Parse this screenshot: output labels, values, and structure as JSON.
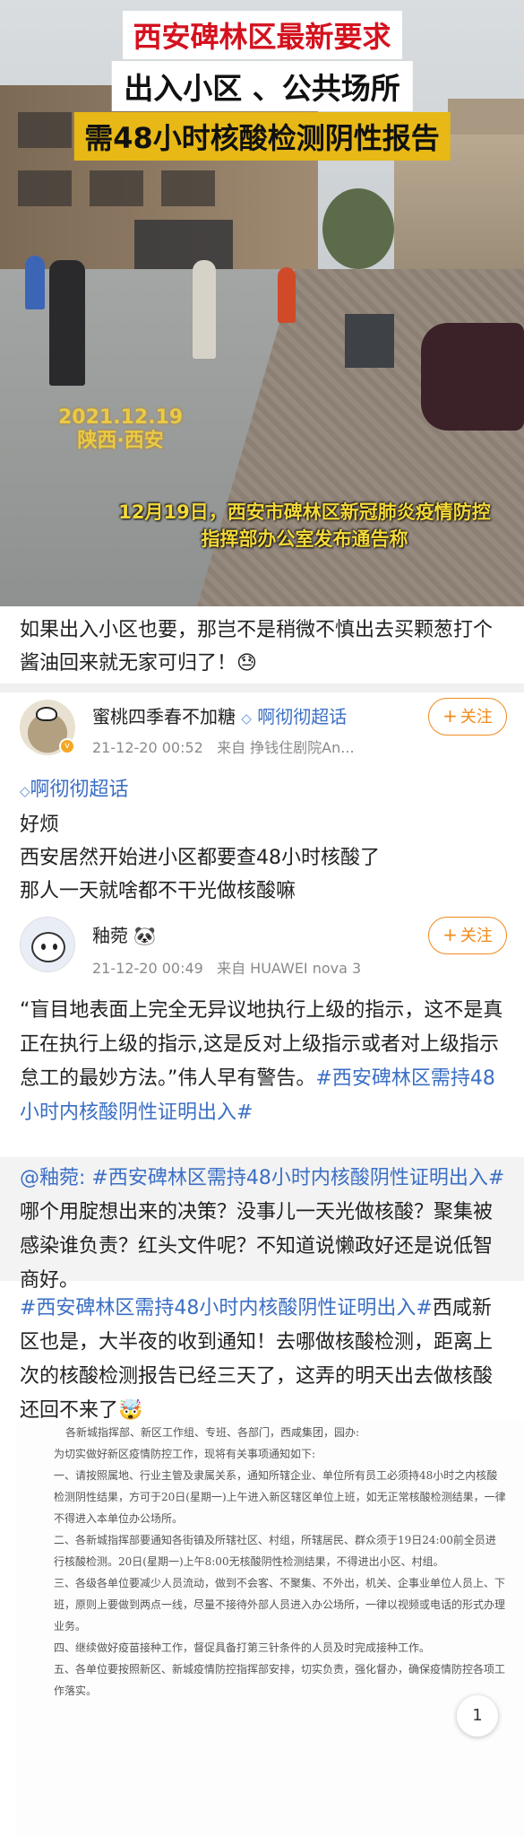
{
  "news_image": {
    "headline_1": "西安碑林区最新要求",
    "headline_2": "出入小区 、公共场所",
    "headline_3": "需48小时核酸检测阴性报告",
    "date_overlay": "2021.12.19",
    "location_overlay": "陕西·西安",
    "caption": "12月19日，西安市碑林区新冠肺炎疫情防控指挥部办公室发布通告称"
  },
  "intro_comment": "如果出入小区也要，那岂不是稍微不慎出去买颗葱打个酱油回来就无家可归了！😓",
  "posts": [
    {
      "username": "蜜桃四季春不加糖",
      "chaohua": "啊彻彻超话",
      "time": "21-12-20 00:52",
      "source": "来自 挣钱住剧院An...",
      "follow_label": "关注",
      "topic_tag": "啊彻彻超话",
      "body": [
        "好烦",
        "西安居然开始进小区都要查48小时核酸了",
        "那人一天就啥都不干光做核酸嘛"
      ]
    },
    {
      "username": "釉菀",
      "time": "21-12-20 00:49",
      "source": "来自 HUAWEI nova 3",
      "follow_label": "关注",
      "body_text": "“盲目地表面上完全无异议地执行上级的指示，这不是真正在执行上级的指示,这是反对上级指示或者对上级指示怠工的最妙方法。”伟人早有警告。",
      "body_tag": "#西安碑林区需持48小时内核酸阴性证明出入#"
    }
  ],
  "repost": {
    "mention": "@釉菀:",
    "tag": "#西安碑林区需持48小时内核酸阴性证明出入#",
    "text": "哪个用腚想出来的决策？没事儿一天光做核酸？聚集被感染谁负责？红头文件呢？不知道说懒政好还是说低智商好。"
  },
  "final_post": {
    "tag": "#西安碑林区需持48小时内核酸阴性证明出入#",
    "text": "西咸新区也是，大半夜的收到通知！去哪做核酸检测，距离上次的核酸检测报告已经三天了，这弄的明天出去做核酸还回不来了🤯"
  },
  "document": {
    "paragraphs": [
      "各新城指挥部、新区工作组、专班、各部门，西咸集团，园办:",
      "为切实做好新区疫情防控工作，现将有关事项通知如下:",
      "一、请按照属地、行业主管及隶属关系，通知所辖企业、单位所有员工必须持48小时之内核酸检测阴性结果，方可于20日(星期一)上午进入新区辖区单位上班，如无正常核酸检测结果，一律不得进入本单位办公场所。",
      "二、各新城指挥部要通知各街镇及所辖社区、村组，所辖居民、群众须于19日24:00前全员进行核酸检测。20日(星期一)上午8:00无核酸阴性检测结果，不得进出小区、村组。",
      "三、各级各单位要减少人员流动，做到不会客、不聚集、不外出，机关、企事业单位人员上、下班，原则上要做到两点一线，尽量不接待外部人员进入办公场所，一律以视频或电话的形式办理业务。",
      "四、继续做好疫苗接种工作，督促具备打第三针条件的人员及时完成接种工作。",
      "五、各单位要按照新区、新城疫情防控指挥部安排，切实负责，强化督办，确保疫情防控各项工作落实。"
    ],
    "page_indicator": "1"
  },
  "colors": {
    "link": "#3b6fc4",
    "follow": "#f08a1c",
    "headline_red": "#d4121e",
    "headline_yellow": "#e7b816",
    "caption_yellow": "#f5d93a"
  }
}
